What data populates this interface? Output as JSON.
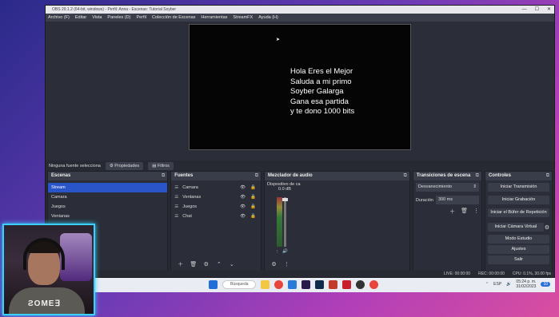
{
  "window": {
    "title": "OBS 29.1.2 (64-bit, windows) - Perfil: Anna - Escenas: Tutorial Soyber",
    "controls": [
      "—",
      "☐",
      "✕"
    ]
  },
  "menu": [
    "Archivo (F)",
    "Editar",
    "Vista",
    "Paneles (D)",
    "Perfil",
    "Colección de Escenas",
    "Herramientas",
    "StreamFX",
    "Ayuda (H)"
  ],
  "preview": {
    "text": "Hola Eres el Mejor\nSaluda a mi primo\nSoyber Galarga\nGana esa partida\ny te dono 1000 bits"
  },
  "source_bar": {
    "status": "Ninguna fuente selecciona",
    "properties": "Propiedades",
    "filters": "Filtros"
  },
  "scenes": {
    "title": "Escenas",
    "items": [
      "Stream",
      "Camara",
      "Juegos",
      "Ventanas"
    ]
  },
  "sources": {
    "title": "Fuentes",
    "items": [
      "Camara",
      "Ventanas",
      "Juegos",
      "Chat"
    ]
  },
  "mixer": {
    "title": "Mezclador de audio",
    "device": "Dispositivo de ca",
    "level": "0.0 dB"
  },
  "transitions": {
    "title": "Transiciones de escena",
    "selected": "Desvanecimiento",
    "duration_label": "Duración",
    "duration_value": "300 ms"
  },
  "controls": {
    "title": "Controles",
    "buttons": [
      "Iniciar Transmisión",
      "Iniciar Grabación",
      "Iniciar el Búfer de Repetición",
      "Iniciar Cámara Virtual",
      "Modo Estudio",
      "Ajustes",
      "Salir"
    ]
  },
  "status": {
    "live": "LIVE: 00:00:00",
    "rec": "REC: 00:00:00",
    "cpu": "CPU: 0.1%, 30.00 fps"
  },
  "taskbar": {
    "search_placeholder": "Búsqueda",
    "lang": "ESP",
    "time": "05:24 p. m.",
    "date": "31/02/2023",
    "badge": "10"
  },
  "webcam": {
    "shirt_text": "ƧOME∃"
  }
}
